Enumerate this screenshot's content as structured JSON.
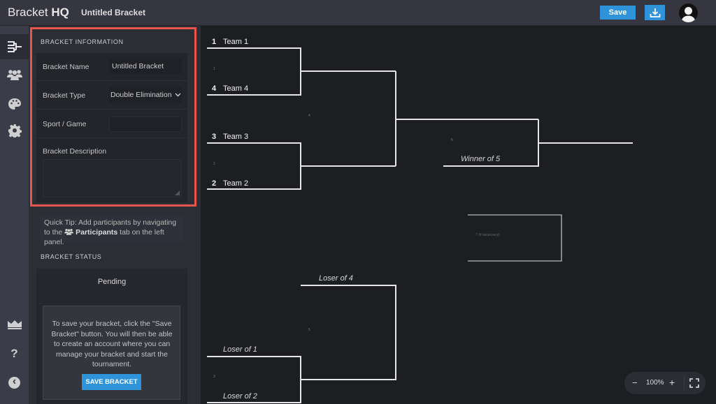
{
  "header": {
    "brand_light": "Bracket ",
    "brand_bold": "HQ",
    "doc_title": "Untitled Bracket",
    "save_label": "Save",
    "download_icon": "download-icon",
    "avatar_icon": "user-avatar-icon"
  },
  "rail": {
    "items": [
      {
        "name": "bracket",
        "icon": "bracket-icon",
        "active": true
      },
      {
        "name": "participants",
        "icon": "users-icon",
        "active": false
      },
      {
        "name": "theme",
        "icon": "palette-icon",
        "active": false
      },
      {
        "name": "settings",
        "icon": "gear-icon",
        "active": false
      }
    ],
    "bottom": [
      {
        "name": "premium",
        "icon": "crown-icon"
      },
      {
        "name": "help",
        "icon": "question-icon",
        "glyph": "?"
      },
      {
        "name": "collapse",
        "icon": "chevron-left-icon",
        "glyph": "‹"
      }
    ]
  },
  "panel": {
    "info_title": "BRACKET INFORMATION",
    "name_label": "Bracket Name",
    "name_value": "Untitled Bracket",
    "type_label": "Bracket Type",
    "type_value": "Double Elimination",
    "sport_label": "Sport / Game",
    "sport_value": "",
    "desc_label": "Bracket Description",
    "desc_value": "",
    "tip_prefix": "Quick Tip: Add participants by navigating to the",
    "tip_bold": "Participants",
    "tip_suffix": "tab on the left panel.",
    "status_title": "BRACKET STATUS",
    "status_value": "Pending",
    "save_info": "To save your bracket, click the \"Save Bracket\" button. You will then be able to create an account where you can manage your bracket and start the tournament.",
    "save_bracket_label": "SAVE BRACKET"
  },
  "bracket": {
    "winners": {
      "round1": [
        {
          "match": "1",
          "top_seed": "1",
          "top_name": "Team 1",
          "bottom_seed": "4",
          "bottom_name": "Team 4"
        },
        {
          "match": "2",
          "top_seed": "3",
          "top_name": "Team 3",
          "bottom_seed": "2",
          "bottom_name": "Team 2"
        }
      ],
      "final_match": "4",
      "grand_final_match": "6",
      "grand_final_bottom": "Winner of 5",
      "reset_match": "7 (if necessary)"
    },
    "losers": {
      "round1": {
        "match": "3",
        "top": "Loser of 1",
        "bottom": "Loser of 2"
      },
      "final": {
        "match": "5",
        "top": "Loser of 4"
      }
    }
  },
  "zoom": {
    "minus": "−",
    "level": "100%",
    "plus": "+",
    "fullscreen_icon": "fullscreen-icon"
  }
}
